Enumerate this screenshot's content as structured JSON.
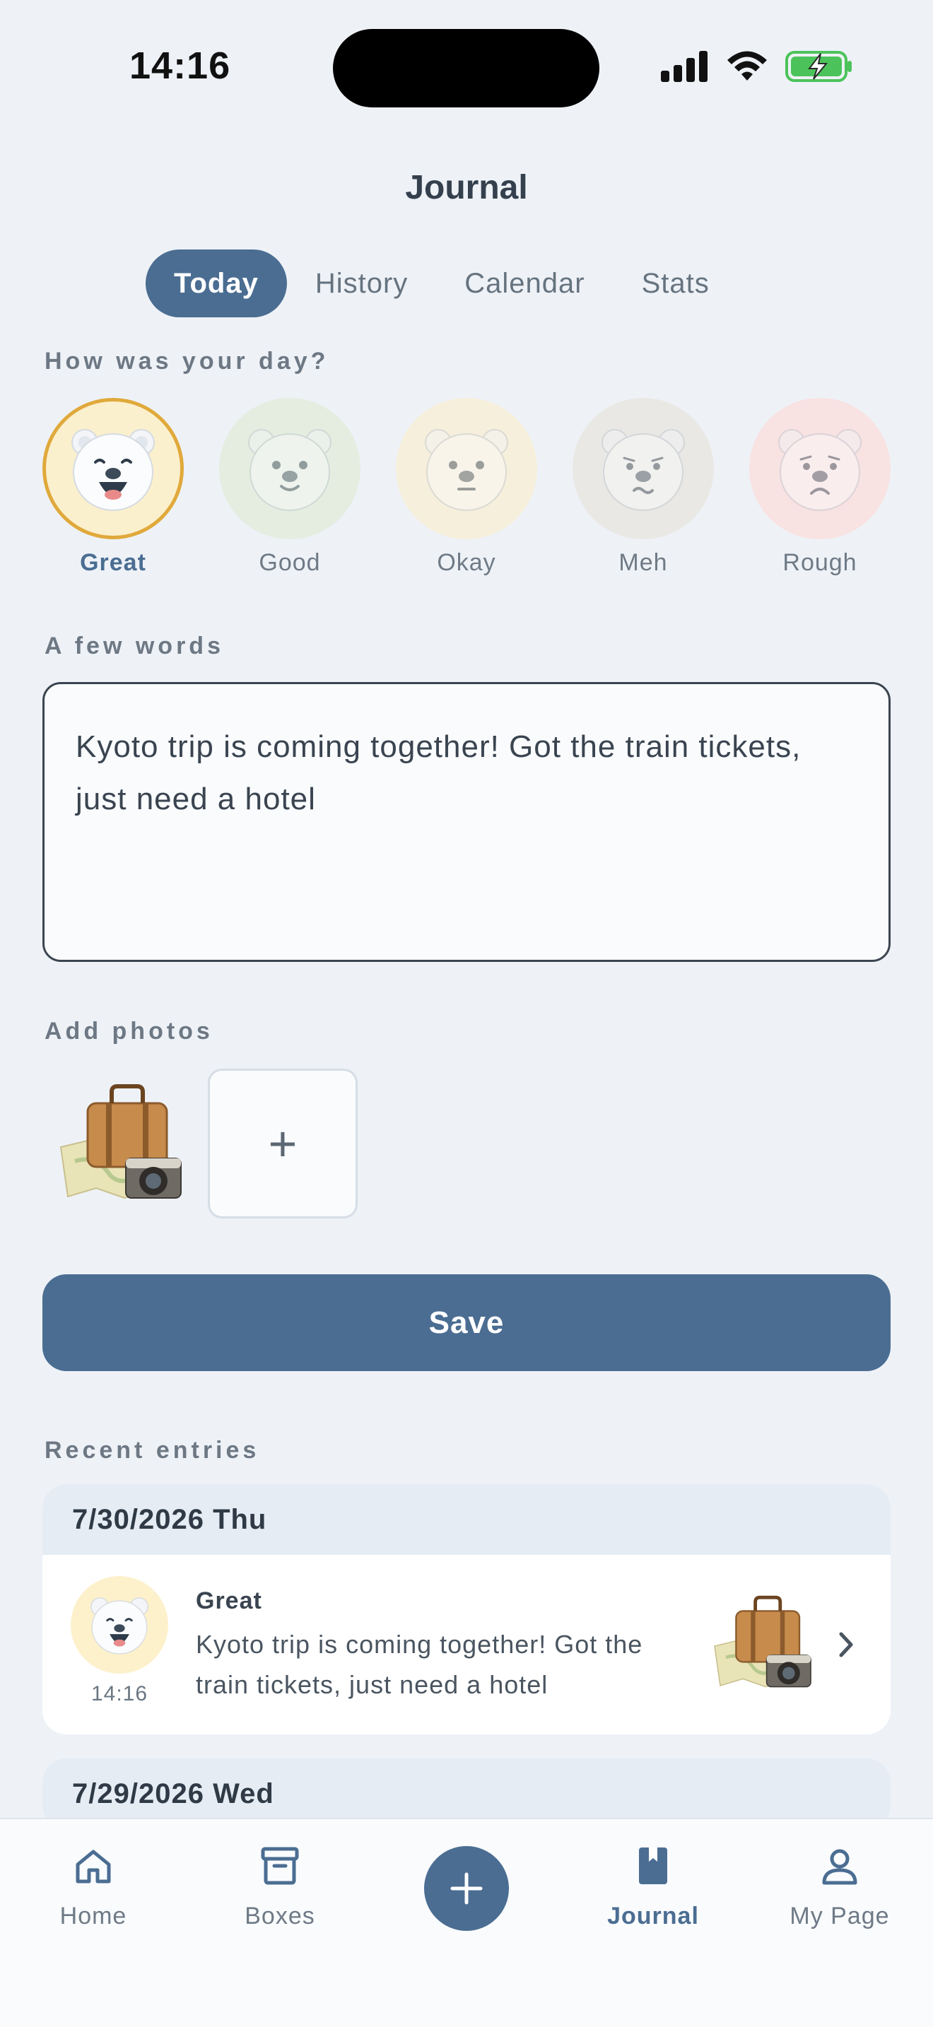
{
  "status": {
    "time": "14:16"
  },
  "header": {
    "title": "Journal"
  },
  "tabs": [
    {
      "label": "Today",
      "active": true
    },
    {
      "label": "History",
      "active": false
    },
    {
      "label": "Calendar",
      "active": false
    },
    {
      "label": "Stats",
      "active": false
    }
  ],
  "mood_section": {
    "label": "How was your day?",
    "options": [
      {
        "label": "Great",
        "selected": true,
        "color": "#fbf0cd"
      },
      {
        "label": "Good",
        "selected": false,
        "color": "#e4ede0"
      },
      {
        "label": "Okay",
        "selected": false,
        "color": "#f6efdc"
      },
      {
        "label": "Meh",
        "selected": false,
        "color": "#e9e8e4"
      },
      {
        "label": "Rough",
        "selected": false,
        "color": "#f8e2e2"
      }
    ]
  },
  "note_section": {
    "label": "A few words",
    "value": "Kyoto trip is coming together! Got the train tickets, just need a hotel"
  },
  "photo_section": {
    "label": "Add photos",
    "thumb_icon": "travel-suitcase-map-camera-icon",
    "add_symbol": "+"
  },
  "save_label": "Save",
  "recent": {
    "label": "Recent entries",
    "entries": [
      {
        "date": "7/30/2026 Thu",
        "mood": "Great",
        "time": "14:16",
        "text": "Kyoto trip is coming together! Got the train tickets, just need a hotel"
      },
      {
        "date": "7/29/2026 Wed"
      }
    ]
  },
  "nav": {
    "items": [
      {
        "label": "Home",
        "icon": "home-icon"
      },
      {
        "label": "Boxes",
        "icon": "box-icon"
      },
      {
        "label": "Journal",
        "icon": "bookmark-icon",
        "active": true
      },
      {
        "label": "My Page",
        "icon": "user-icon"
      }
    ],
    "fab_icon": "plus-icon"
  },
  "colors": {
    "accent": "#4b6d92",
    "selected_ring": "#e0a93b",
    "background": "#eef2f7"
  }
}
